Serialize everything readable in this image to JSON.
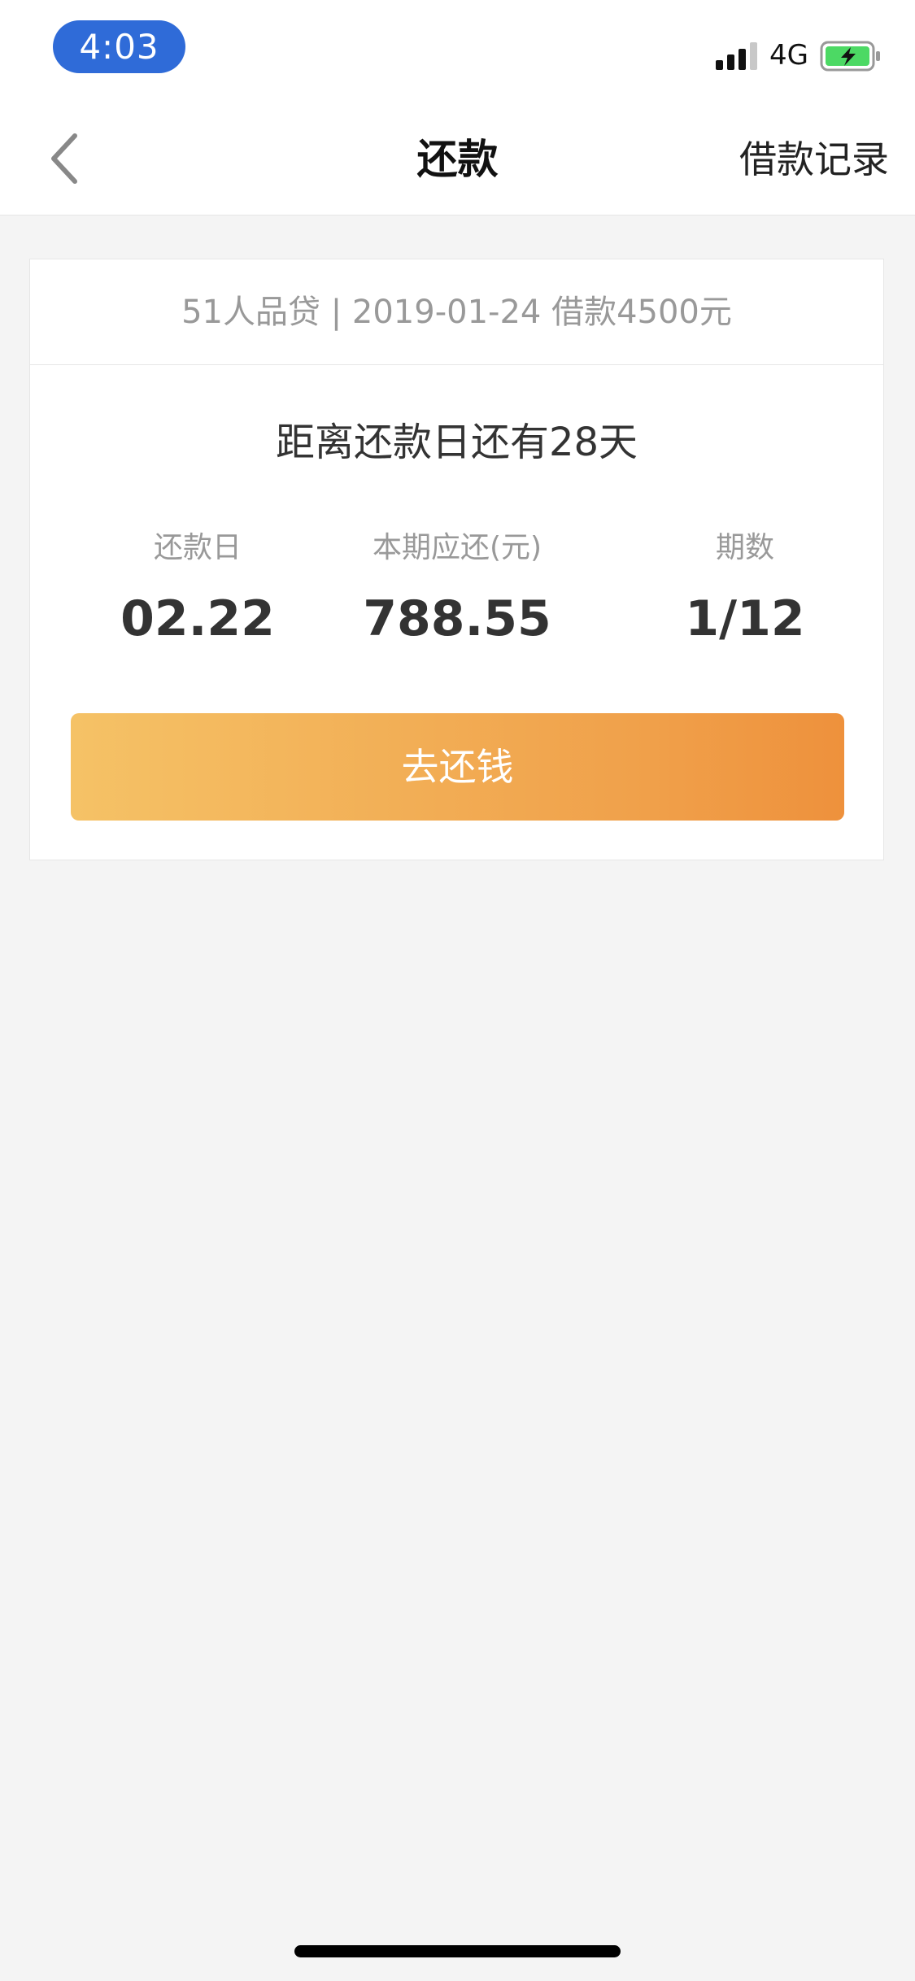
{
  "status_bar": {
    "time": "4:03",
    "network": "4G",
    "signal_icon": "signal-bars-icon",
    "battery_icon": "battery-charging-icon",
    "battery_color": "#4cd964"
  },
  "nav": {
    "back_icon": "chevron-left-icon",
    "title": "还款",
    "right_label": "借款记录"
  },
  "card": {
    "header": "51人品贷 | 2019-01-24 借款4500元",
    "countdown": "距离还款日还有28天",
    "stats": {
      "due_date_label": "还款日",
      "due_date_value": "02.22",
      "amount_label": "本期应还(元)",
      "amount_value": "788.55",
      "period_label": "期数",
      "period_value": "1/12"
    },
    "pay_button": "去还钱"
  },
  "colors": {
    "time_pill": "#2f6bd8",
    "button_start": "#f5c266",
    "button_end": "#ee913c",
    "background": "#f4f4f4"
  }
}
